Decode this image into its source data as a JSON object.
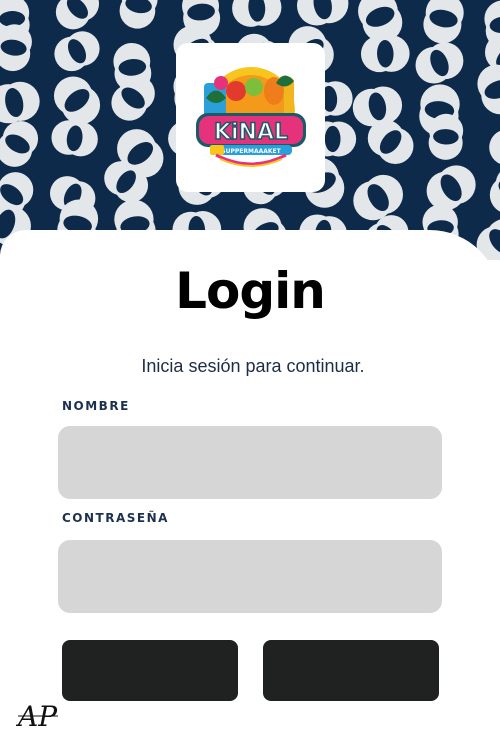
{
  "header": {
    "logo_text": "KiNAL",
    "logo_subtext": "SUPPERMAAAKET",
    "accent_colors": [
      "#0e2a4a",
      "#e3e7ea",
      "#e6327a",
      "#2a9fd8",
      "#f7c51e",
      "#1f6f3a"
    ]
  },
  "login": {
    "title": "Login",
    "subtitle": "Inicia sesión para continuar.",
    "username_label": "NOMBRE",
    "username_value": "",
    "password_label": "CONTRASEÑA",
    "password_value": "",
    "primary_button_label": "",
    "secondary_button_label": ""
  },
  "footer": {
    "monogram": "AP"
  }
}
